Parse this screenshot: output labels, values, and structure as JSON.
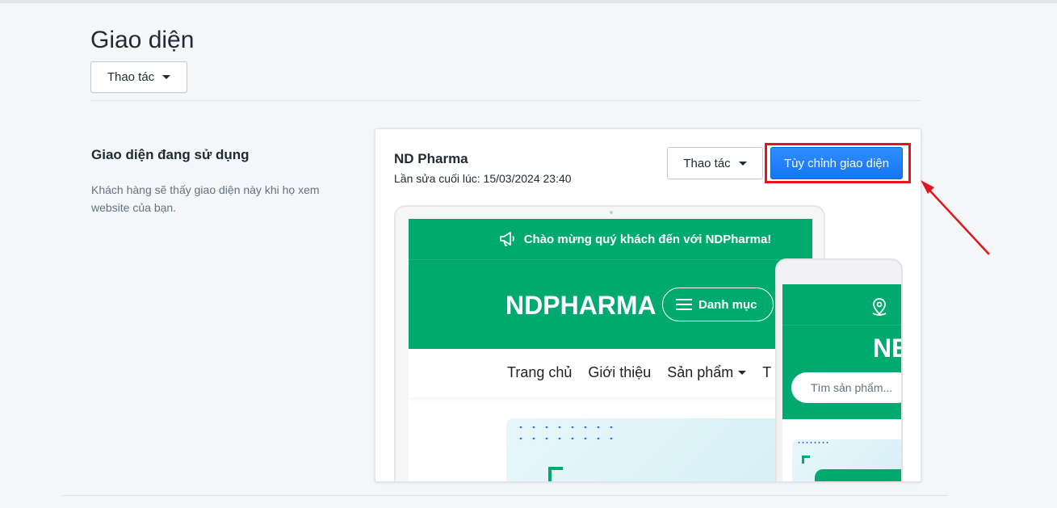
{
  "page": {
    "title": "Giao diện",
    "actions_label": "Thao tác"
  },
  "section": {
    "title": "Giao diện đang sử dụng",
    "description": "Khách hàng sẽ thấy giao diện này khi họ xem website của bạn."
  },
  "theme": {
    "name": "ND Pharma",
    "last_edited": "Lần sửa cuối lúc: 15/03/2024 23:40",
    "actions_label": "Thao tác",
    "customize_label": "Tùy chỉnh giao diện"
  },
  "preview": {
    "announcement_prefix": "Chào mừng quý khách đến với ",
    "announcement_brand": "NDPharma!",
    "logo": "NDPHARMA",
    "menu_label": "Danh mục",
    "nav": [
      "Trang chủ",
      "Giới thiệu",
      "Sản phẩm",
      "T"
    ],
    "mobile_logo": "NE",
    "mobile_search_placeholder": "Tìm sản phẩm..."
  },
  "colors": {
    "brand_green": "#00a96e",
    "primary_blue": "#1775f1",
    "highlight_red": "#e3161b"
  }
}
